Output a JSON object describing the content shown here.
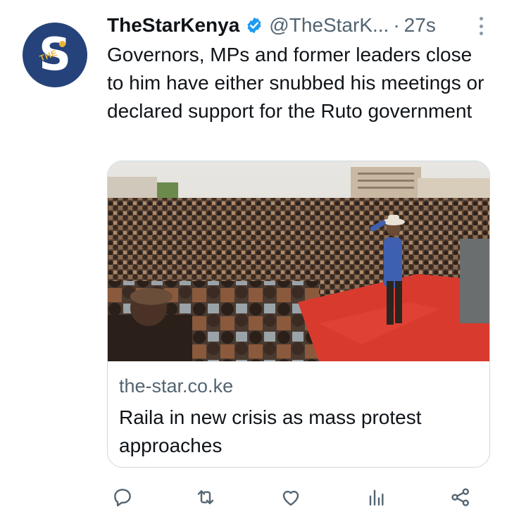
{
  "tweet": {
    "author_name": "TheStarKenya",
    "author_handle": "@TheStarK...",
    "separator": "·",
    "time": "27s",
    "text": "Governors, MPs and former leaders close to him have either snubbed his meetings or declared support for the Ruto government",
    "avatar": {
      "letter": "S",
      "small_text": "THE"
    }
  },
  "card": {
    "domain": "the-star.co.ke",
    "title": "Raila in new crisis as mass protest approaches",
    "image_icon": "crowd-rally-photo"
  },
  "actions": [
    {
      "name": "reply",
      "icon": "reply-icon"
    },
    {
      "name": "retweet",
      "icon": "retweet-icon"
    },
    {
      "name": "like",
      "icon": "heart-icon"
    },
    {
      "name": "views",
      "icon": "bar-chart-icon"
    },
    {
      "name": "share",
      "icon": "share-icon"
    }
  ],
  "colors": {
    "brand_avatar": "#25437a",
    "verified": "#1d9bf0",
    "secondary_text": "#536471",
    "icon": "#536471"
  }
}
